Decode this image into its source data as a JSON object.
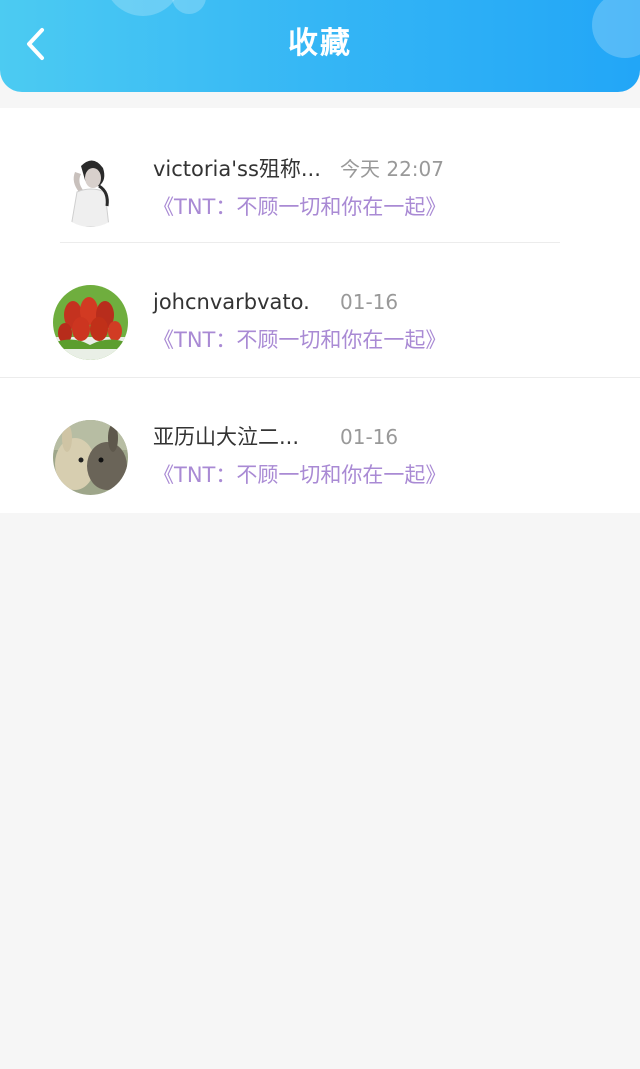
{
  "header": {
    "title": "收藏",
    "back_icon": "chevron-left-icon",
    "gradient": [
      "#4ccbf2",
      "#22a6f7"
    ]
  },
  "favorites": [
    {
      "name": "victoria'ss殂称...",
      "time": "今天 22:07",
      "post": "《TNT：不顾一切和你在一起》"
    },
    {
      "name": "johcnvarbvato.",
      "time": "01-16",
      "post": "《TNT：不顾一切和你在一起》"
    },
    {
      "name": "亚历山大泣二...",
      "time": "01-16",
      "post": "《TNT：不顾一切和你在一起》"
    }
  ],
  "colors": {
    "post_link": "#a98ad4",
    "name": "#333333",
    "time": "#999999"
  }
}
